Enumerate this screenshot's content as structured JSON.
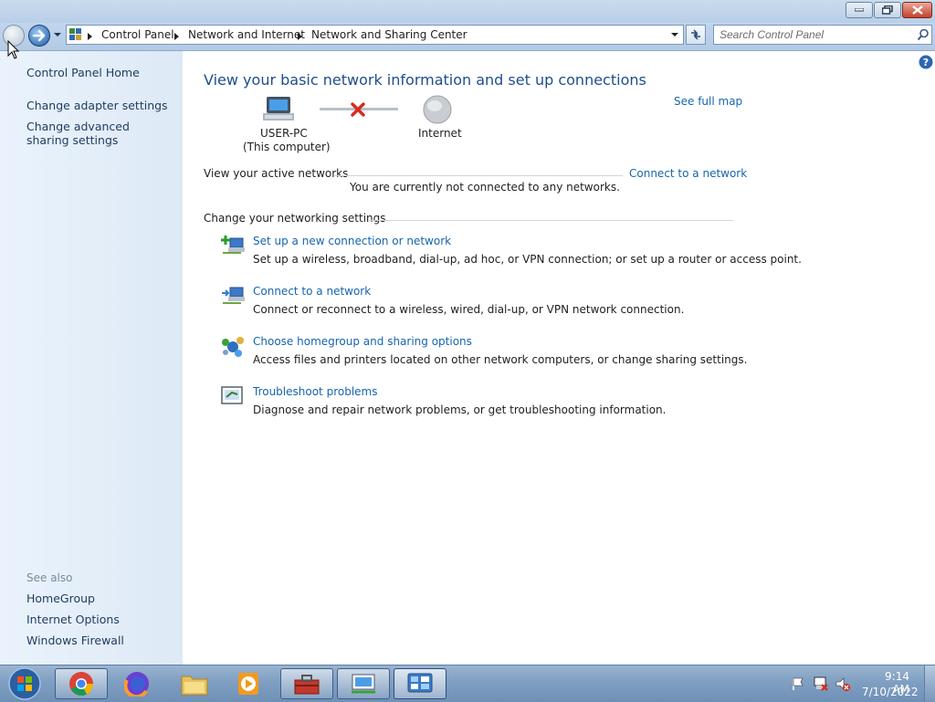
{
  "window": {
    "breadcrumb": [
      "Control Panel",
      "Network and Internet",
      "Network and Sharing Center"
    ],
    "search_placeholder": "Search Control Panel"
  },
  "sidebar": {
    "home": "Control Panel Home",
    "links": [
      "Change adapter settings",
      "Change advanced sharing settings"
    ],
    "see_also_heading": "See also",
    "see_also": [
      "HomeGroup",
      "Internet Options",
      "Windows Firewall"
    ]
  },
  "main": {
    "heading": "View your basic network information and set up connections",
    "see_full_map": "See full map",
    "computer_name": "USER-PC",
    "computer_sub": "(This computer)",
    "internet_label": "Internet",
    "active_networks_label": "View your active networks",
    "connect_link": "Connect to a network",
    "not_connected": "You are currently not connected to any networks.",
    "settings_label": "Change your networking settings",
    "tasks": [
      {
        "title": "Set up a new connection or network",
        "desc": "Set up a wireless, broadband, dial-up, ad hoc, or VPN connection; or set up a router or access point.",
        "icon": "new-connection-icon"
      },
      {
        "title": "Connect to a network",
        "desc": "Connect or reconnect to a wireless, wired, dial-up, or VPN network connection.",
        "icon": "connect-network-icon"
      },
      {
        "title": "Choose homegroup and sharing options",
        "desc": "Access files and printers located on other network computers, or change sharing settings.",
        "icon": "homegroup-icon"
      },
      {
        "title": "Troubleshoot problems",
        "desc": "Diagnose and repair network problems, or get troubleshooting information.",
        "icon": "troubleshoot-icon"
      }
    ]
  },
  "taskbar": {
    "apps": [
      "start-orb",
      "chrome-icon",
      "firefox-icon",
      "explorer-icon",
      "media-player-icon",
      "toolbox-icon",
      "network-icon",
      "control-panel-icon"
    ],
    "time": "9:14 AM",
    "date": "7/10/2022"
  },
  "colors": {
    "link": "#1565ae",
    "heading": "#1e4e8c",
    "sidebar_bg": "#e4eef9",
    "error_x": "#d62a1e"
  }
}
